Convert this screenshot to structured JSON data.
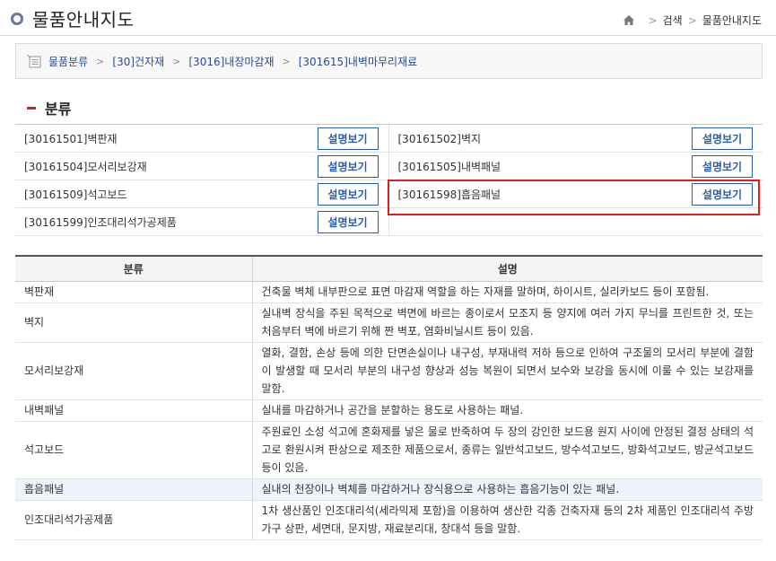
{
  "header": {
    "title": "물품안내지도",
    "breadcrumb": [
      "검색",
      "물품안내지도"
    ]
  },
  "path": {
    "items": [
      "물품분류",
      "[30]건자재",
      "[3016]내장마감재",
      "[301615]내벽마무리재료"
    ]
  },
  "section": {
    "title": "분류"
  },
  "categories": {
    "button_label": "설명보기",
    "rows": [
      {
        "left": "[30161501]벽판재",
        "right": "[30161502]벽지"
      },
      {
        "left": "[30161504]모서리보강재",
        "right": "[30161505]내벽패널"
      },
      {
        "left": "[30161509]석고보드",
        "right": "[30161598]흡음패널"
      },
      {
        "left": "[30161599]인조대리석가공제품",
        "right": ""
      }
    ]
  },
  "table": {
    "headers": [
      "분류",
      "설명"
    ],
    "rows": [
      {
        "name": "벽판재",
        "desc": "건축물 벽체 내부판으로 표면 마감재 역할을 하는 자재를 말하며, 하이시트, 실리카보드 등이 포함됨."
      },
      {
        "name": "벽지",
        "desc": "실내벽 장식을 주된 목적으로 벽면에 바르는 종이로서 모조지 등 양지에 여러 가지 무늬를 프린트한 것, 또는 처음부터 벽에 바르기 위해 짠 벽포, 염화비닐시트 등이 있음."
      },
      {
        "name": "모서리보강재",
        "desc": "열화, 결함, 손상 등에 의한 단면손실이나 내구성, 부재내력 저하 등으로 인하여 구조물의 모서리 부분에 결함이 발생할 때 모서리 부분의 내구성 향상과 성능 복원이 되면서 보수와 보강을 동시에 이룰 수 있는 보강재를 말함."
      },
      {
        "name": "내벽패널",
        "desc": "실내를 마감하거나 공간을 분할하는 용도로 사용하는 패널."
      },
      {
        "name": "석고보드",
        "desc": "주원료인 소성 석고에 혼화제를 넣은 물로 반죽하여 두 장의 강인한 보드용 원지 사이에 안정된 결정 상태의 석고로 환원시켜 판상으로 제조한 제품으로서, 종류는 일반석고보드, 방수석고보드, 방화석고보드, 방균석고보드 등이 있음."
      },
      {
        "name": "흡음패널",
        "desc": "실내의 천장이나 벽체를 마감하거나 장식용으로 사용하는 흡음기능이 있는 패널."
      },
      {
        "name": "인조대리석가공제품",
        "desc": "1차 생산품인 인조대리석(세라믹제 포함)을 이용하여 생산한 각종 건축자재 등의 2차 제품인 인조대리석 주방가구 상판, 세면대, 문지방, 재료분리대, 창대석 등을 말함."
      }
    ]
  },
  "colors": {
    "accent": "#2b5ea8",
    "highlight": "#e41e1e",
    "section_marker": "#d21f2b"
  }
}
